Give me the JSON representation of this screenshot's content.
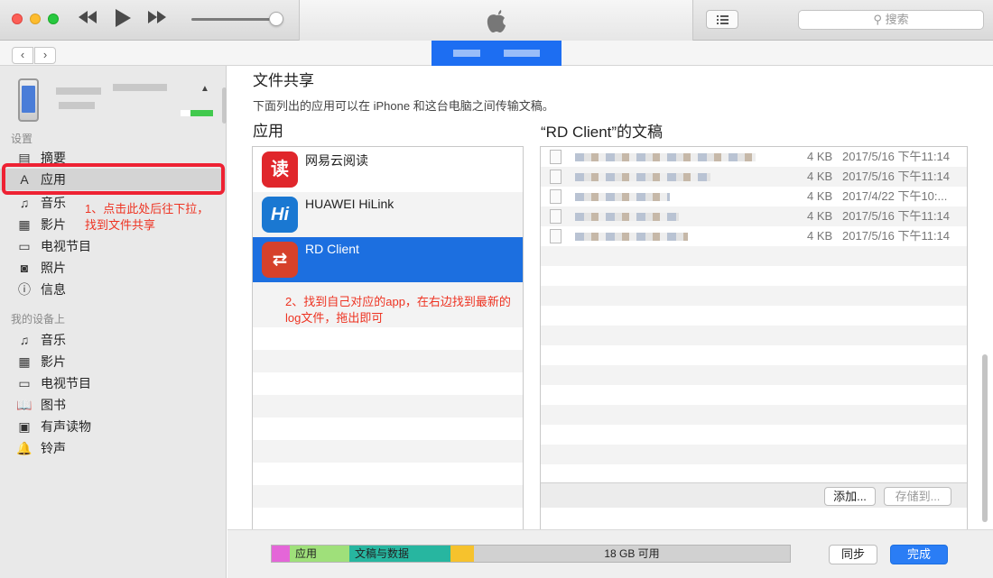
{
  "toolbar": {
    "search_placeholder": "搜索"
  },
  "sidebar": {
    "settings_heading": "设置",
    "settings_items": [
      {
        "label": "摘要",
        "icon": "summary-icon"
      },
      {
        "label": "应用",
        "icon": "app-store-icon"
      },
      {
        "label": "音乐",
        "icon": "music-note-icon"
      },
      {
        "label": "影片",
        "icon": "film-icon"
      },
      {
        "label": "电视节目",
        "icon": "tv-icon"
      },
      {
        "label": "照片",
        "icon": "camera-icon"
      },
      {
        "label": "信息",
        "icon": "info-icon"
      }
    ],
    "on_device_heading": "我的设备上",
    "device_items": [
      {
        "label": "音乐",
        "icon": "music-note-icon"
      },
      {
        "label": "影片",
        "icon": "film-icon"
      },
      {
        "label": "电视节目",
        "icon": "tv-icon"
      },
      {
        "label": "图书",
        "icon": "book-icon"
      },
      {
        "label": "有声读物",
        "icon": "audiobook-icon"
      },
      {
        "label": "铃声",
        "icon": "bell-icon"
      }
    ],
    "annotation": "1、点击此处后往下拉，找到文件共享"
  },
  "main": {
    "section_title": "文件共享",
    "description": "下面列出的应用可以在 iPhone 和这台电脑之间传输文稿。",
    "apps_title": "应用",
    "docs_title": "“RD Client”的文稿",
    "apps": [
      {
        "name": "网易云阅读",
        "icon_char": "读",
        "color": "#e0262b"
      },
      {
        "name": "HUAWEI HiLink",
        "icon_char": "Hi",
        "color": "#1a78d2"
      },
      {
        "name": "RD Client",
        "icon_char": "⇄",
        "color": "#d6412b"
      }
    ],
    "selected_app": "RD Client",
    "annotation": "2、找到自己对应的app，在右边找到最新的log文件，拖出即可",
    "documents": [
      {
        "size": "4 KB",
        "date": "2017/5/16 下午11:14"
      },
      {
        "size": "4 KB",
        "date": "2017/5/16 下午11:14"
      },
      {
        "size": "4 KB",
        "date": "2017/4/22 下午10:..."
      },
      {
        "size": "4 KB",
        "date": "2017/5/16 下午11:14"
      },
      {
        "size": "4 KB",
        "date": "2017/5/16 下午11:14"
      }
    ],
    "add_button": "添加...",
    "save_button": "存储到..."
  },
  "bottom": {
    "segments": [
      {
        "label": "",
        "color": "#e466d8"
      },
      {
        "label": "应用",
        "color": "#9fe07a"
      },
      {
        "label": "文稿与数据",
        "color": "#27b6a0"
      },
      {
        "label": "",
        "color": "#f6c22d"
      },
      {
        "label": "18 GB 可用",
        "color": "#d1d1d1"
      }
    ],
    "sync_button": "同步",
    "done_button": "完成"
  }
}
